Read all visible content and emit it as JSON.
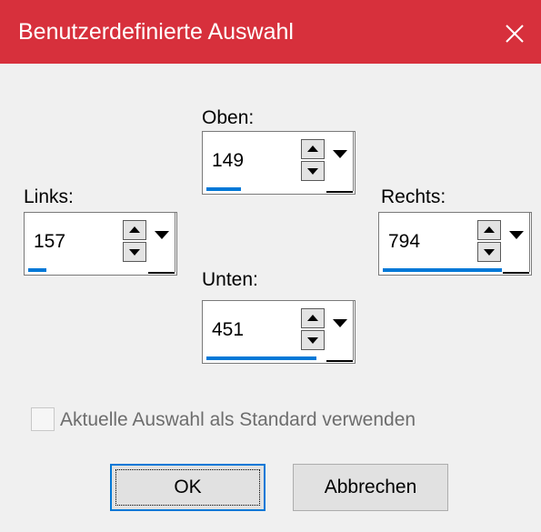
{
  "dialog": {
    "title": "Benutzerdefinierte Auswahl",
    "close_icon": "close-icon",
    "accent_color": "#d7303c",
    "progress_color": "#0078d7"
  },
  "fields": {
    "top": {
      "label": "Oben:",
      "value": "149",
      "fill_fraction": 0.28
    },
    "left": {
      "label": "Links:",
      "value": "157",
      "fill_fraction": 0.15
    },
    "right": {
      "label": "Rechts:",
      "value": "794",
      "fill_fraction": 0.98
    },
    "bottom": {
      "label": "Unten:",
      "value": "451",
      "fill_fraction": 0.9
    }
  },
  "checkbox": {
    "label": "Aktuelle Auswahl als Standard verwenden",
    "checked": false,
    "enabled": false
  },
  "buttons": {
    "ok": "OK",
    "cancel": "Abbrechen"
  }
}
